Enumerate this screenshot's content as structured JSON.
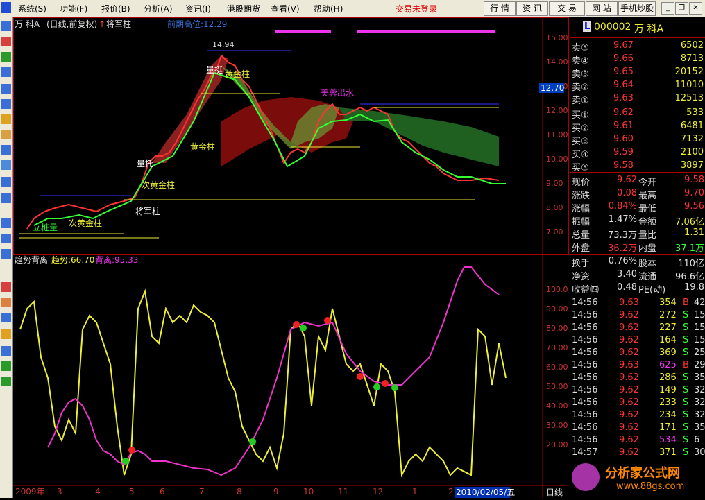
{
  "menu": {
    "items": [
      "系统(S)",
      "功能(F)",
      "报价(B)",
      "分析(A)",
      "资讯(I)",
      "港股期货",
      "查看(V)",
      "帮助(H)"
    ],
    "status": "交易未登录",
    "toolbar": [
      "行 情",
      "资 讯",
      "交 易",
      "网 站",
      "手机炒股"
    ]
  },
  "chart": {
    "title_stock": "万 科A",
    "title_mode": "(日线,前复权)",
    "title_indicator": "将军柱",
    "prev_high": "前期高位:12.29",
    "max_label": "14.94",
    "current_price_tag": "12.70",
    "yaxis_ticks": [
      "15.00",
      "14.00",
      "13.00",
      "12.00",
      "11.00",
      "10.00",
      "9.00",
      "8.00",
      "7.00"
    ],
    "lower_title": "趋势背离",
    "lower_trend": "趋势:66.70",
    "lower_bg": "背离:95.33",
    "lower_ticks": [
      "100.0",
      "90.00",
      "80.00",
      "70.00",
      "60.00",
      "50.00",
      "40.00",
      "30.00",
      "20.00"
    ],
    "xaxis": [
      "2009年",
      "3",
      "4",
      "5",
      "6",
      "7",
      "8",
      "9",
      "10",
      "11",
      "12",
      "1",
      "2"
    ],
    "xaxis_date": "2010/02/05/五",
    "period": "日线",
    "annotations": [
      "黄金柱",
      "次黄金柱",
      "将军柱",
      "量托",
      "量挺",
      "美蓉出水",
      "立桩量",
      "次黄金柱",
      "黄金柱"
    ]
  },
  "quote": {
    "code": "000002",
    "name": "万  科A",
    "asks": [
      {
        "label": "卖⑤",
        "price": "9.67",
        "vol": "6502"
      },
      {
        "label": "卖④",
        "price": "9.66",
        "vol": "8713"
      },
      {
        "label": "卖③",
        "price": "9.65",
        "vol": "20152"
      },
      {
        "label": "卖②",
        "price": "9.64",
        "vol": "11010"
      },
      {
        "label": "卖①",
        "price": "9.63",
        "vol": "12513"
      }
    ],
    "bids": [
      {
        "label": "买①",
        "price": "9.62",
        "vol": "533"
      },
      {
        "label": "买②",
        "price": "9.61",
        "vol": "6481"
      },
      {
        "label": "买③",
        "price": "9.60",
        "vol": "7132"
      },
      {
        "label": "买④",
        "price": "9.59",
        "vol": "2100"
      },
      {
        "label": "买⑤",
        "price": "9.58",
        "vol": "3897"
      }
    ],
    "stats": [
      {
        "l1": "现价",
        "v1": "9.62",
        "l2": "今开",
        "v2": "9.58"
      },
      {
        "l1": "涨跌",
        "v1": "0.08",
        "l2": "最高",
        "v2": "9.70"
      },
      {
        "l1": "涨幅",
        "v1": "0.84%",
        "l2": "最低",
        "v2": "9.56"
      },
      {
        "l1": "振幅",
        "v1": "1.47%",
        "l2": "金额",
        "v2": "7.06亿"
      },
      {
        "l1": "总量",
        "v1": "73.3万",
        "l2": "量比",
        "v2": "1.31"
      },
      {
        "l1": "外盘",
        "v1": "36.2万",
        "l2": "内盘",
        "v2": "37.1万"
      }
    ],
    "stats2": [
      {
        "l1": "换手",
        "v1": "0.76%",
        "l2": "股本",
        "v2": "110亿"
      },
      {
        "l1": "净资",
        "v1": "3.40",
        "l2": "流通",
        "v2": "96.6亿"
      },
      {
        "l1": "收益㈣",
        "v1": "0.48",
        "l2": "PE(动)",
        "v2": "19.8"
      }
    ],
    "ticks": [
      {
        "t": "14:56",
        "p": "9.63",
        "v": "354",
        "bs": "B",
        "n": "42"
      },
      {
        "t": "14:56",
        "p": "9.62",
        "v": "272",
        "bs": "S",
        "n": "15"
      },
      {
        "t": "14:56",
        "p": "9.62",
        "v": "227",
        "bs": "S",
        "n": "15"
      },
      {
        "t": "14:56",
        "p": "9.62",
        "v": "164",
        "bs": "S",
        "n": "15"
      },
      {
        "t": "14:56",
        "p": "9.62",
        "v": "369",
        "bs": "S",
        "n": "25"
      },
      {
        "t": "14:56",
        "p": "9.63",
        "v": "625",
        "bs": "B",
        "n": "29"
      },
      {
        "t": "14:56",
        "p": "9.62",
        "v": "286",
        "bs": "S",
        "n": "35"
      },
      {
        "t": "14:56",
        "p": "9.62",
        "v": "149",
        "bs": "S",
        "n": "32"
      },
      {
        "t": "14:56",
        "p": "9.62",
        "v": "233",
        "bs": "S",
        "n": "32"
      },
      {
        "t": "14:56",
        "p": "9.62",
        "v": "234",
        "bs": "S",
        "n": "32"
      },
      {
        "t": "14:56",
        "p": "9.62",
        "v": "171",
        "bs": "S",
        "n": "35"
      },
      {
        "t": "14:56",
        "p": "9.62",
        "v": "534",
        "bs": "S",
        "n": "6"
      },
      {
        "t": "14:57",
        "p": "9.62",
        "v": "371",
        "bs": "S",
        "n": "30"
      }
    ],
    "watermark": "分析家公式网",
    "watermark_url": "www.88gs.com"
  }
}
